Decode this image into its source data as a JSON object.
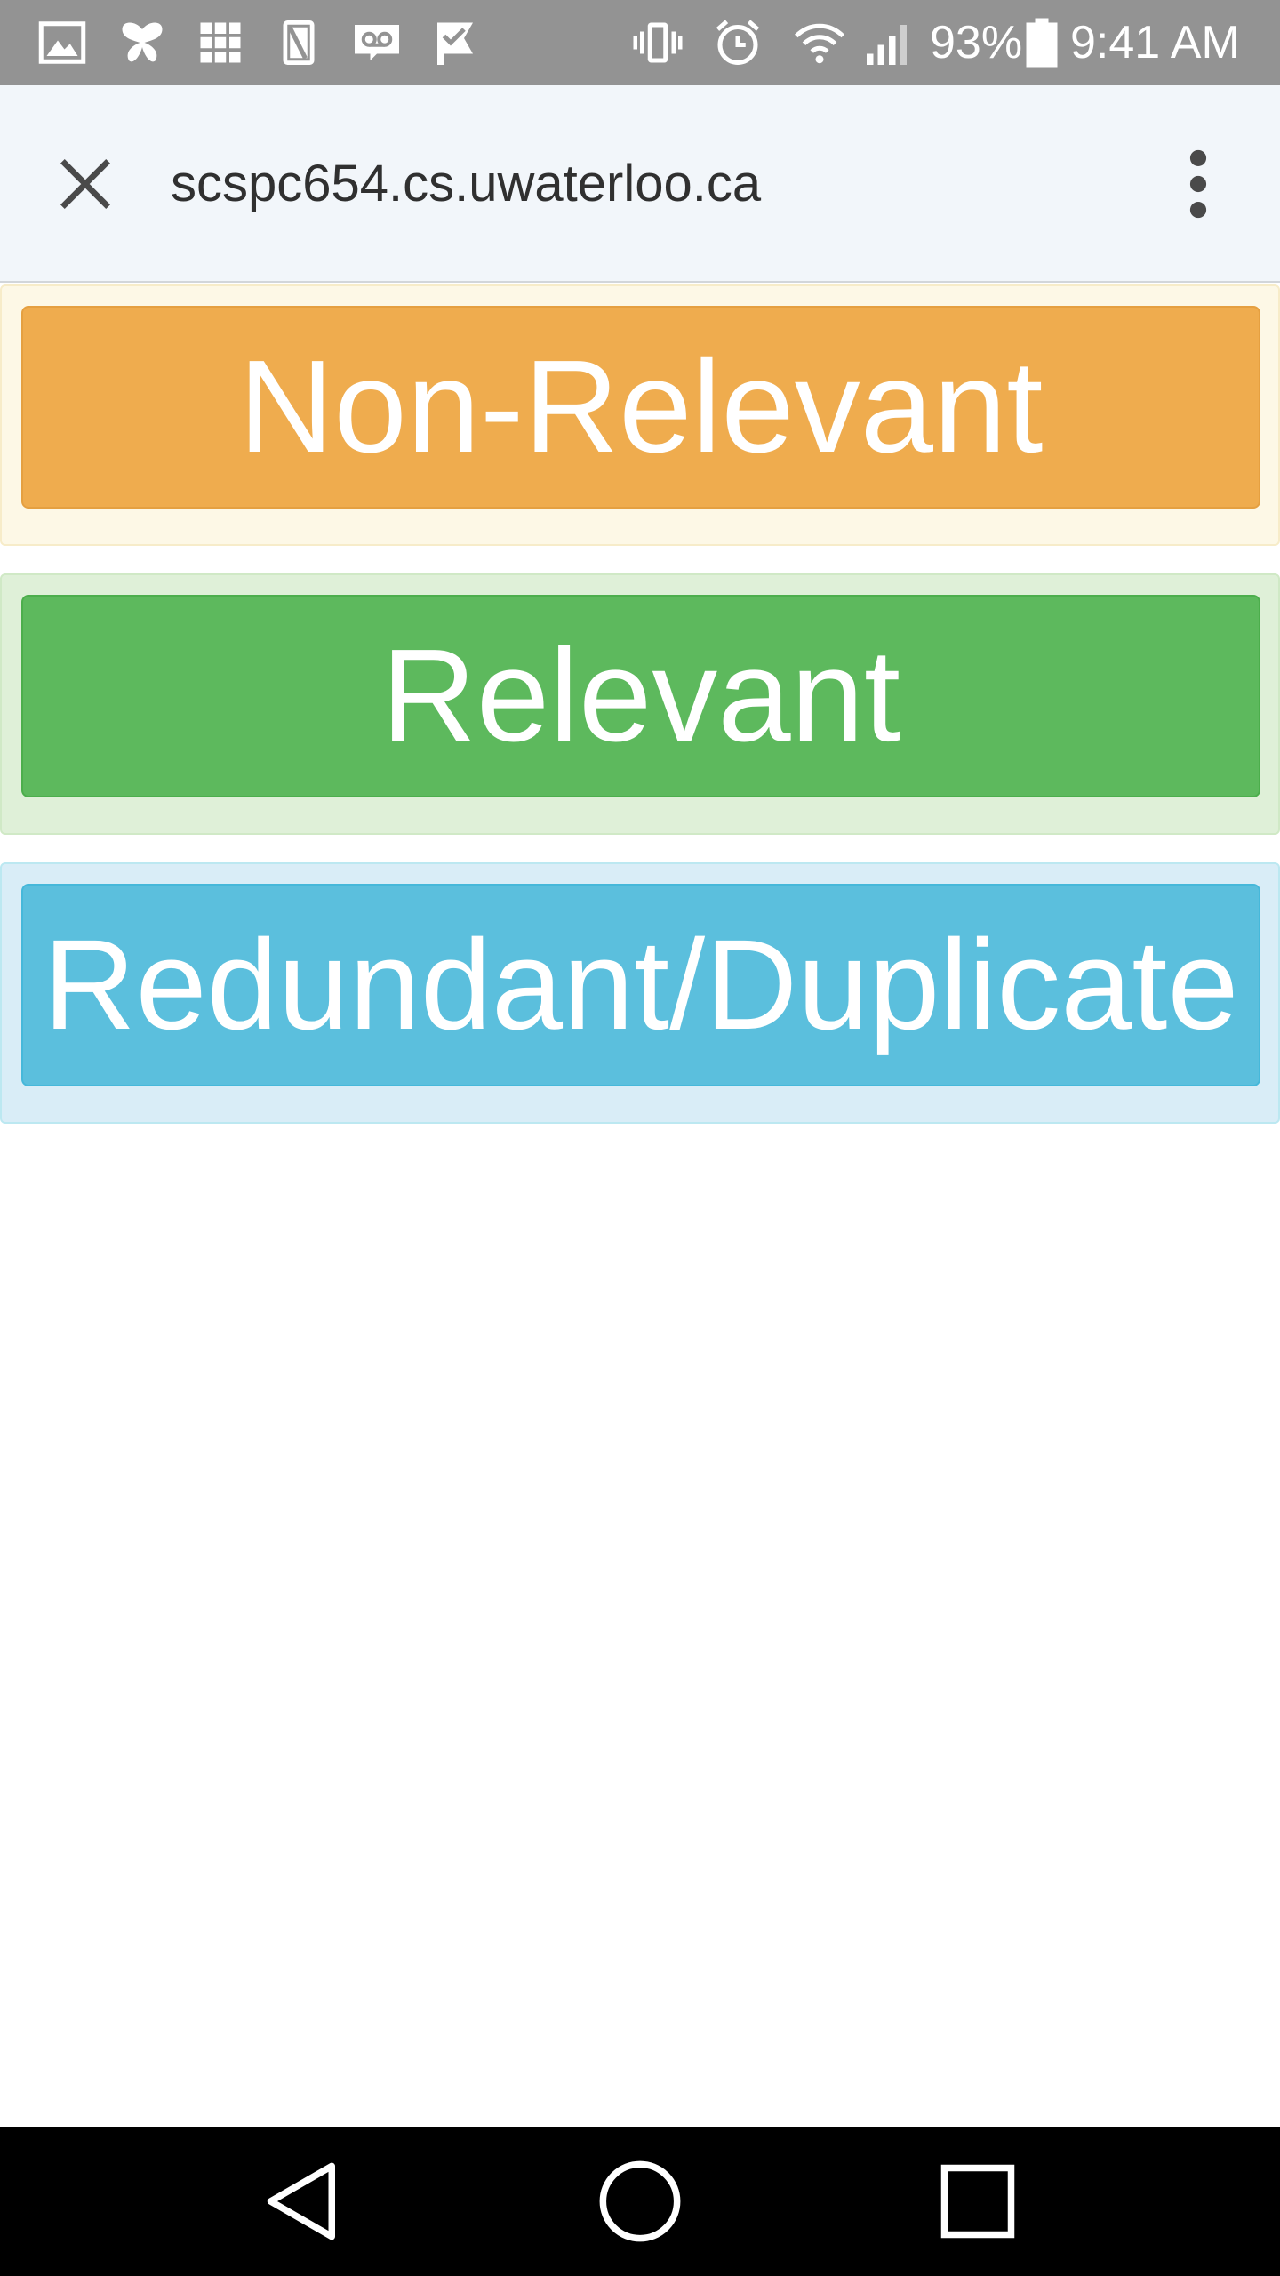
{
  "status_bar": {
    "battery_percent": "93%",
    "time": "9:41 AM",
    "notification_icons": [
      "gallery-icon",
      "butterfly-icon",
      "apps-grid-icon",
      "sim-card-icon",
      "voicemail-icon",
      "check-flag-icon"
    ],
    "system_icons": [
      "vibrate-icon",
      "alarm-icon",
      "wifi-icon",
      "signal-icon",
      "battery-icon"
    ]
  },
  "toolbar": {
    "url": "scspc654.cs.uwaterloo.ca",
    "close_icon": "close-icon",
    "menu_icon": "more-vert-icon"
  },
  "judgments": [
    {
      "label": "Non-Relevant",
      "style": "warning",
      "color": "#efac4e"
    },
    {
      "label": "Relevant",
      "style": "success",
      "color": "#5db95d"
    },
    {
      "label": "Redundant/Duplicate",
      "style": "info",
      "color": "#5bbfdd"
    }
  ],
  "nav_bar": {
    "buttons": [
      "back-icon",
      "home-icon",
      "recents-icon"
    ]
  }
}
